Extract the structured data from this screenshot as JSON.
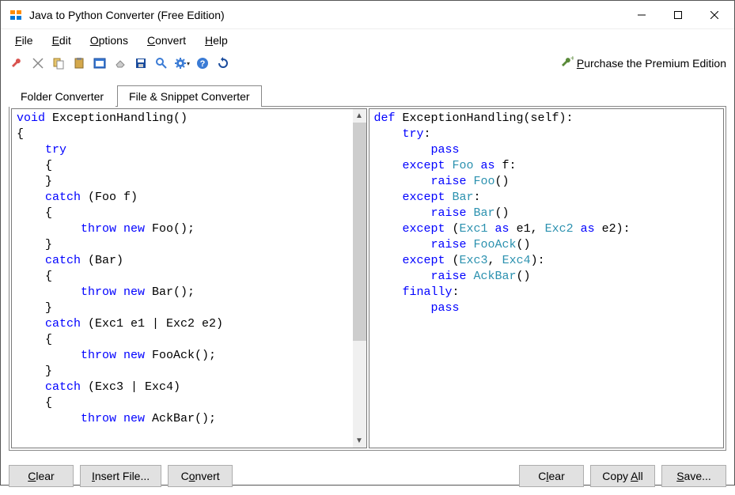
{
  "app": {
    "title": "Java to Python Converter (Free Edition)"
  },
  "menus": {
    "file": "File",
    "edit": "Edit",
    "options": "Options",
    "convert": "Convert",
    "help": "Help"
  },
  "premium_link": "Purchase the Premium Edition",
  "tabs": {
    "folder": "Folder Converter",
    "snippet": "File & Snippet Converter"
  },
  "source_code": {
    "line1a": "void",
    "line1b": " ExceptionHandling()",
    "line2": "{",
    "line3a": "    try",
    "line4": "    {",
    "line5": "    }",
    "line6a": "    catch",
    "line6b": " (Foo f)",
    "line7": "    {",
    "line8a": "         throw",
    "line8b": " new",
    "line8c": " Foo();",
    "line9": "    }",
    "line10a": "    catch",
    "line10b": " (Bar)",
    "line11": "    {",
    "line12a": "         throw",
    "line12b": " new",
    "line12c": " Bar();",
    "line13": "    }",
    "line14a": "    catch",
    "line14b": " (Exc1 e1 | Exc2 e2)",
    "line15": "    {",
    "line16a": "         throw",
    "line16b": " new",
    "line16c": " FooAck();",
    "line17": "    }",
    "line18a": "    catch",
    "line18b": " (Exc3 | Exc4)",
    "line19": "    {",
    "line20a": "         throw",
    "line20b": " new",
    "line20c": " AckBar();"
  },
  "target_code": {
    "line1a": "def",
    "line1b": " ExceptionHandling(self):",
    "line2a": "    try",
    "line2b": ":",
    "line3a": "        pass",
    "line4a": "    except",
    "line4b": " Foo",
    "line4c": " as",
    "line4d": " f:",
    "line5a": "        raise",
    "line5b": " Foo",
    "line5c": "()",
    "line6a": "    except",
    "line6b": " Bar",
    "line6c": ":",
    "line7a": "        raise",
    "line7b": " Bar",
    "line7c": "()",
    "line8a": "    except",
    "line8b": " (",
    "line8c": "Exc1",
    "line8d": " as",
    "line8e": " e1, ",
    "line8f": "Exc2",
    "line8g": " as",
    "line8h": " e2):",
    "line9a": "        raise",
    "line9b": " FooAck",
    "line9c": "()",
    "line10a": "    except",
    "line10b": " (",
    "line10c": "Exc3",
    "line10d": ", ",
    "line10e": "Exc4",
    "line10f": "):",
    "line11a": "        raise",
    "line11b": " AckBar",
    "line11c": "()",
    "line12a": "    finally",
    "line12b": ":",
    "line13a": "        pass"
  },
  "buttons": {
    "clear_left": "Clear",
    "insert_file": "Insert File...",
    "convert": "Convert",
    "clear_right": "Clear",
    "copy_all": "Copy All",
    "save": "Save..."
  }
}
